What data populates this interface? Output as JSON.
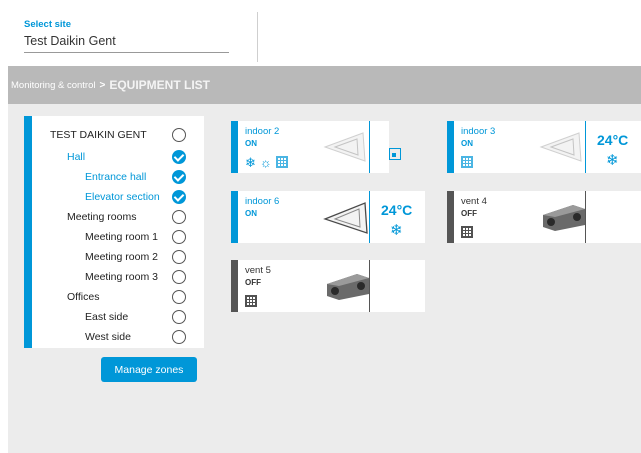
{
  "site": {
    "label": "Select site",
    "value": "Test Daikin Gent"
  },
  "breadcrumb": {
    "parent": "Monitoring & control",
    "separator": ">",
    "current": "EQUIPMENT LIST"
  },
  "tree": {
    "items": [
      {
        "label": "TEST DAIKIN GENT",
        "checked": false
      },
      {
        "label": "Hall",
        "checked": true
      },
      {
        "label": "Entrance hall",
        "checked": true
      },
      {
        "label": "Elevator section",
        "checked": true
      },
      {
        "label": "Meeting rooms",
        "checked": false
      },
      {
        "label": "Meeting room 1",
        "checked": false
      },
      {
        "label": "Meeting room 2",
        "checked": false
      },
      {
        "label": "Meeting room 3",
        "checked": false
      },
      {
        "label": "Offices",
        "checked": false
      },
      {
        "label": "East side",
        "checked": false
      },
      {
        "label": "West side",
        "checked": false
      }
    ],
    "manage_label": "Manage zones"
  },
  "equipment": [
    {
      "name": "indoor 2",
      "state": "ON",
      "temp": "",
      "icons": [
        "snowflake-icon",
        "sun-icon",
        "grid-icon"
      ],
      "side_icon": "remote-icon"
    },
    {
      "name": "indoor 3",
      "state": "ON",
      "temp": "24°C",
      "icons": [
        "grid-icon"
      ],
      "side_icon": "snowflake-icon"
    },
    {
      "name": "indoor 6",
      "state": "ON",
      "temp": "24°C",
      "icons": [],
      "side_icon": "snowflake-icon"
    },
    {
      "name": "vent 4",
      "state": "OFF",
      "temp": "",
      "icons": [
        "grid-icon"
      ],
      "side_icon": ""
    },
    {
      "name": "vent 5",
      "state": "OFF",
      "temp": "",
      "icons": [
        "grid-icon"
      ],
      "side_icon": ""
    }
  ],
  "colors": {
    "accent": "#0097d8",
    "off": "#555555",
    "breadcrumb_bg": "#b9b9b9",
    "panel_bg": "#ececec"
  }
}
